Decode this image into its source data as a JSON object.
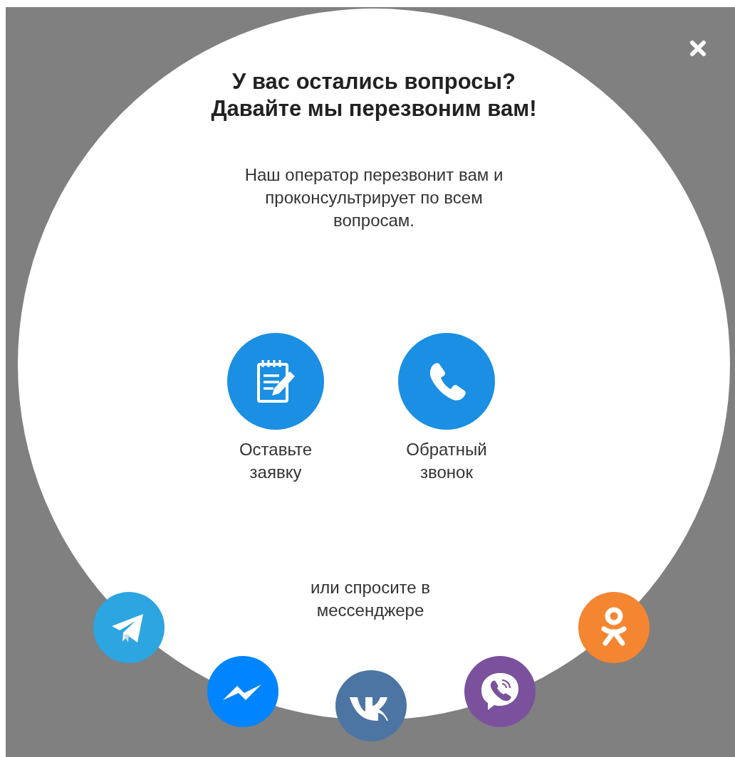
{
  "title": "У вас остались вопросы? Давайте мы перезвоним вам!",
  "description": "Наш оператор перезвонит вам и проконсультрирует по всем вопросам.",
  "actions": [
    {
      "kind": "form",
      "label": "Оставьте заявку"
    },
    {
      "kind": "call",
      "label": "Обратный звонок"
    }
  ],
  "messenger_prompt": "или спросите в мессенджере",
  "messengers": [
    {
      "kind": "telegram"
    },
    {
      "kind": "messenger"
    },
    {
      "kind": "vk"
    },
    {
      "kind": "viber"
    },
    {
      "kind": "ok"
    }
  ]
}
